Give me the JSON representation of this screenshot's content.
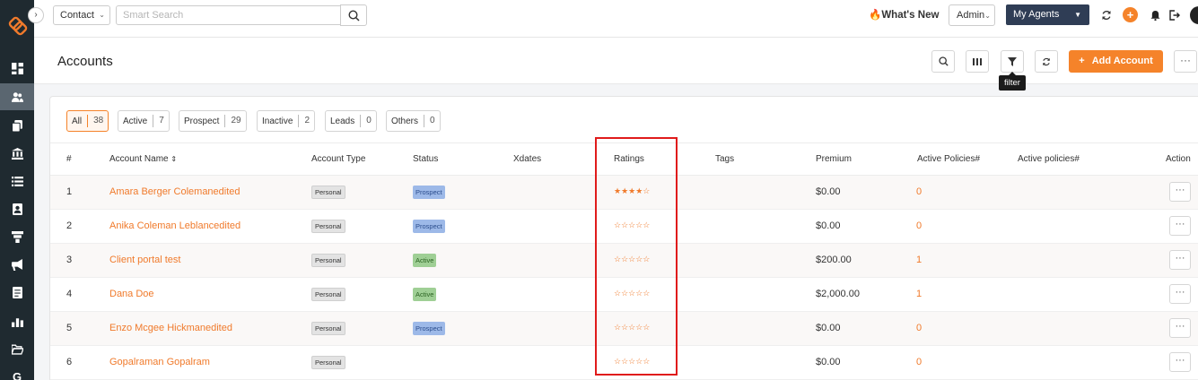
{
  "topbar": {
    "contact_select": "Contact",
    "search_placeholder": "Smart Search",
    "whats_new": "What's New",
    "admin_select": "Admin",
    "agents_select": "My Agents"
  },
  "page": {
    "title": "Accounts",
    "add_button": "Add Account",
    "filter_tooltip": "filter",
    "more_label": "···"
  },
  "filters": [
    {
      "label": "All",
      "count": "38"
    },
    {
      "label": "Active",
      "count": "7"
    },
    {
      "label": "Prospect",
      "count": "29"
    },
    {
      "label": "Inactive",
      "count": "2"
    },
    {
      "label": "Leads",
      "count": "0"
    },
    {
      "label": "Others",
      "count": "0"
    }
  ],
  "table": {
    "headers": {
      "num": "#",
      "name": "Account Name",
      "type": "Account Type",
      "status": "Status",
      "xdates": "Xdates",
      "ratings": "Ratings",
      "tags": "Tags",
      "premium": "Premium",
      "active_policies": "Active Policies#",
      "active_policies_2": "Active policies#",
      "action": "Action"
    },
    "rows": [
      {
        "num": "1",
        "name": "Amara Berger Colemanedited",
        "type": "Personal",
        "status": "Prospect",
        "stars": "★★★★☆",
        "premium": "$0.00",
        "policies": "0"
      },
      {
        "num": "2",
        "name": "Anika Coleman Leblancedited",
        "type": "Personal",
        "status": "Prospect",
        "stars": "☆☆☆☆☆",
        "premium": "$0.00",
        "policies": "0"
      },
      {
        "num": "3",
        "name": "Client portal test",
        "type": "Personal",
        "status": "Active",
        "stars": "☆☆☆☆☆",
        "premium": "$200.00",
        "policies": "1"
      },
      {
        "num": "4",
        "name": "Dana Doe",
        "type": "Personal",
        "status": "Active",
        "stars": "☆☆☆☆☆",
        "premium": "$2,000.00",
        "policies": "1"
      },
      {
        "num": "5",
        "name": "Enzo Mcgee Hickmanedited",
        "type": "Personal",
        "status": "Prospect",
        "stars": "☆☆☆☆☆",
        "premium": "$0.00",
        "policies": "0"
      },
      {
        "num": "6",
        "name": "Gopalraman Gopalram",
        "type": "Personal",
        "status": "",
        "stars": "☆☆☆☆☆",
        "premium": "$0.00",
        "policies": "0"
      }
    ],
    "action_label": "···"
  },
  "sidebar": {
    "letter_item": "G"
  },
  "colors": {
    "accent": "#f5832a",
    "sidebar_bg": "#1f2a30",
    "highlight": "#e01b1b"
  }
}
